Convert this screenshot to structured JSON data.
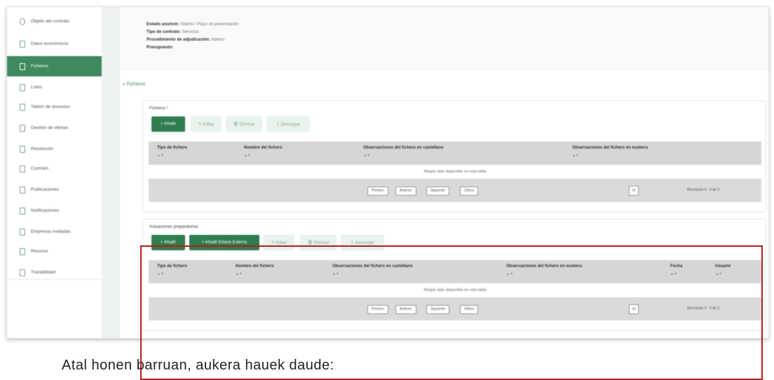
{
  "sidebar": {
    "items": [
      {
        "label": "Objeto del contrato",
        "icon": "circle-icon",
        "active": false
      },
      {
        "label": "Datos económicos",
        "icon": "document-icon",
        "active": false
      },
      {
        "label": "Ficheros",
        "icon": "document-icon",
        "active": true
      },
      {
        "label": "Lotes",
        "icon": "document-icon",
        "active": false
      },
      {
        "label": "Tablón de anuncios",
        "icon": "document-icon",
        "active": false
      },
      {
        "label": "Gestión de ofertas",
        "icon": "document-icon",
        "active": false
      },
      {
        "label": "Resolución",
        "icon": "document-icon",
        "active": false
      },
      {
        "label": "Contrato",
        "icon": "document-icon",
        "active": false
      },
      {
        "label": "Publicaciones",
        "icon": "document-icon",
        "active": false
      },
      {
        "label": "Notificaciones",
        "icon": "document-icon",
        "active": false
      },
      {
        "label": "Empresas invitadas",
        "icon": "document-icon",
        "active": false
      },
      {
        "label": "Recurso",
        "icon": "document-icon",
        "active": false
      },
      {
        "label": "Trazabilidad",
        "icon": "document-icon",
        "active": false
      }
    ]
  },
  "info": {
    "estado_label": "Estado anuncio:",
    "estado_value": "Abierto / Plazo de presentación",
    "tipo_label": "Tipo de contrato:",
    "tipo_value": "Servicios",
    "proc_label": "Procedimiento de adjudicación:",
    "proc_value": "Abierto",
    "presupuesto_label": "Presupuesto:",
    "presupuesto_value": ""
  },
  "section": {
    "title": "Ficheros"
  },
  "ficheros": {
    "label": "Ficheros *",
    "buttons": {
      "add": "+ Añadir",
      "edit": "✎ Editar",
      "delete": "🗑 Eliminar",
      "download": "⇩ Descargar"
    },
    "headers": [
      "Tipo de fichero",
      "Nombre del fichero",
      "Observaciones del fichero en castellano",
      "Observaciones del fichero en euskera"
    ],
    "sort_glyph": "▲▼",
    "empty": "Ningún dato disponible en esta tabla",
    "pagination": {
      "first": "Primero",
      "prev": "Anterior",
      "next": "Siguiente",
      "last": "Último",
      "page_size": "10",
      "info": "Mostrando 0 - 0 de 0"
    }
  },
  "actuaciones": {
    "label": "Actuaciones preparatorias",
    "buttons": {
      "add": "+ Añadir",
      "add_link": "+ Añadir Enlace Externo",
      "edit": "✎ Editar",
      "delete": "🗑 Eliminar",
      "download": "⇩ Descargar"
    },
    "headers": [
      "Tipo de fichero",
      "Nombre del fichero",
      "Observaciones del fichero en castellano",
      "Observaciones del fichero en euskera",
      "Fecha",
      "Usuario"
    ],
    "sort_glyph": "▲▼",
    "empty": "Ningún dato disponible en esta tabla",
    "pagination": {
      "first": "Primero",
      "prev": "Anterior",
      "next": "Siguiente",
      "last": "Último",
      "page_size": "10",
      "info": "Mostrando 0 - 0 de 0"
    }
  },
  "caption": "Atal honen barruan, aukera hauek daude:",
  "colors": {
    "accent": "#3e8a5e",
    "highlight": "#b51d1d"
  }
}
